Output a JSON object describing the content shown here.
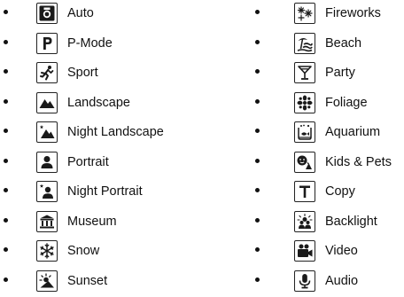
{
  "modes_left": [
    {
      "label": "Auto",
      "icon": "camera-icon"
    },
    {
      "label": "P-Mode",
      "icon": "p-letter-icon"
    },
    {
      "label": "Sport",
      "icon": "runner-icon"
    },
    {
      "label": "Landscape",
      "icon": "mountain-icon"
    },
    {
      "label": "Night Landscape",
      "icon": "night-mountain-icon"
    },
    {
      "label": "Portrait",
      "icon": "person-icon"
    },
    {
      "label": "Night Portrait",
      "icon": "night-person-icon"
    },
    {
      "label": "Museum",
      "icon": "museum-icon"
    },
    {
      "label": "Snow",
      "icon": "snowflake-icon"
    },
    {
      "label": "Sunset",
      "icon": "sunset-icon"
    }
  ],
  "modes_right": [
    {
      "label": "Fireworks",
      "icon": "fireworks-icon"
    },
    {
      "label": "Beach",
      "icon": "beach-icon"
    },
    {
      "label": "Party",
      "icon": "cocktail-glass-icon"
    },
    {
      "label": "Foliage",
      "icon": "foliage-icon"
    },
    {
      "label": "Aquarium",
      "icon": "fish-tank-icon"
    },
    {
      "label": "Kids & Pets",
      "icon": "kids-pets-icon"
    },
    {
      "label": "Copy",
      "icon": "t-letter-icon"
    },
    {
      "label": "Backlight",
      "icon": "backlight-icon"
    },
    {
      "label": "Video",
      "icon": "video-camera-icon"
    },
    {
      "label": "Audio",
      "icon": "microphone-icon"
    }
  ]
}
